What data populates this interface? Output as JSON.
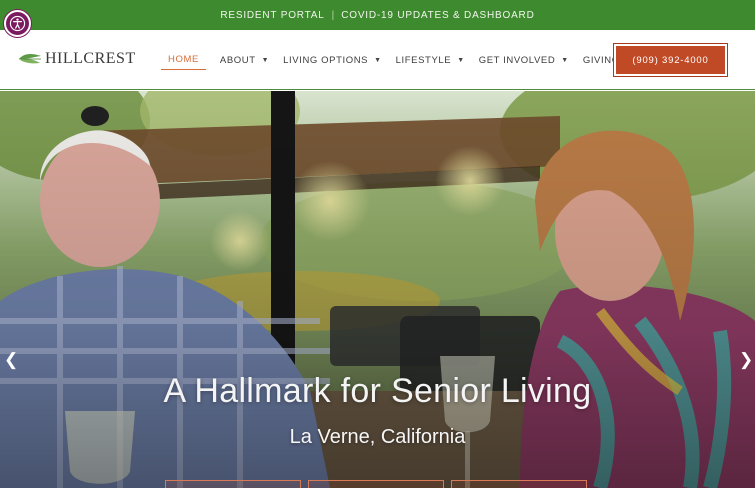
{
  "topbar": {
    "links": [
      "RESIDENT PORTAL",
      "COVID-19 UPDATES & DASHBOARD"
    ],
    "separator": "|"
  },
  "accessibility": {
    "icon": "accessibility-icon",
    "color": "#7a1b62"
  },
  "header": {
    "logo_text": "HILLCREST",
    "nav": [
      {
        "label": "HOME",
        "active": true,
        "dropdown": false
      },
      {
        "label": "ABOUT",
        "active": false,
        "dropdown": true
      },
      {
        "label": "LIVING OPTIONS",
        "active": false,
        "dropdown": true
      },
      {
        "label": "LIFESTYLE",
        "active": false,
        "dropdown": true
      },
      {
        "label": "GET INVOLVED",
        "active": false,
        "dropdown": true
      },
      {
        "label": "GIVING",
        "active": false,
        "dropdown": false
      }
    ],
    "phone_label": "(909) 392-4000"
  },
  "hero": {
    "headline": "A Hallmark for Senior Living",
    "subline": "La Verne, California",
    "prev_icon": "chevron-left-icon",
    "next_icon": "chevron-right-icon"
  },
  "colors": {
    "topbar": "#3e8a2f",
    "accent": "#c14a26",
    "active_nav": "#d76e3a"
  }
}
